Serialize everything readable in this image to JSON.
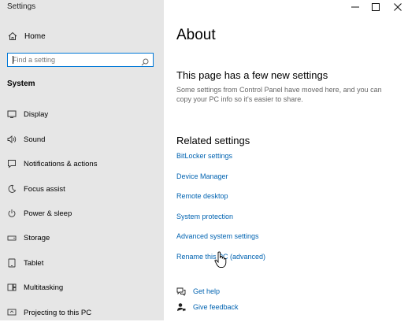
{
  "app": {
    "title": "Settings"
  },
  "sidebar": {
    "home_label": "Home",
    "search_placeholder": "Find a setting",
    "section_title": "System",
    "items": [
      {
        "label": "Display",
        "icon": "display-icon"
      },
      {
        "label": "Sound",
        "icon": "sound-icon"
      },
      {
        "label": "Notifications & actions",
        "icon": "notifications-icon"
      },
      {
        "label": "Focus assist",
        "icon": "focus-assist-icon"
      },
      {
        "label": "Power & sleep",
        "icon": "power-icon"
      },
      {
        "label": "Storage",
        "icon": "storage-icon"
      },
      {
        "label": "Tablet",
        "icon": "tablet-icon"
      },
      {
        "label": "Multitasking",
        "icon": "multitasking-icon"
      },
      {
        "label": "Projecting to this PC",
        "icon": "projecting-icon"
      }
    ]
  },
  "main": {
    "title": "About",
    "notice_heading": "This page has a few new settings",
    "notice_text": "Some settings from Control Panel have moved here, and you can copy your PC info so it's easier to share.",
    "related_heading": "Related settings",
    "related_links": [
      "BitLocker settings",
      "Device Manager",
      "Remote desktop",
      "System protection",
      "Advanced system settings",
      "Rename this PC (advanced)"
    ],
    "help_links": [
      {
        "label": "Get help",
        "icon": "get-help-icon"
      },
      {
        "label": "Give feedback",
        "icon": "give-feedback-icon"
      }
    ]
  },
  "colors": {
    "accent": "#0078d7",
    "link": "#0063b1",
    "sidebar_bg": "#e6e6e6"
  }
}
